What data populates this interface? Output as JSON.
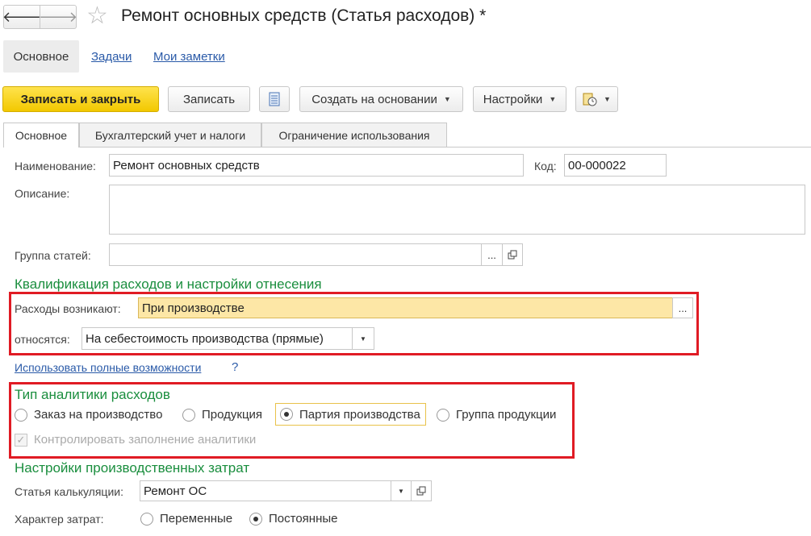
{
  "title": "Ремонт основных средств (Статья расходов) *",
  "nav": {
    "back": "🡐",
    "forward": "🡒",
    "star": "☆"
  },
  "views": {
    "main": "Основное",
    "tasks": "Задачи",
    "notes": "Мои заметки"
  },
  "toolbar": {
    "save_close": "Записать и закрыть",
    "save": "Записать",
    "create_based": "Создать на основании",
    "settings": "Настройки"
  },
  "tabs": [
    "Основное",
    "Бухгалтерский учет и налоги",
    "Ограничение использования"
  ],
  "form": {
    "name_label": "Наименование:",
    "name_value": "Ремонт основных средств",
    "code_label": "Код:",
    "code_value": "00-000022",
    "desc_label": "Описание:",
    "group_label": "Группа статей:",
    "group_value": ""
  },
  "qualification": {
    "header": "Квалификация расходов и настройки отнесения",
    "arise_label": "Расходы возникают:",
    "arise_value": "При производстве",
    "relate_label": "относятся:",
    "relate_value": "На себестоимость производства (прямые)",
    "full_link": "Использовать полные возможности",
    "help": "?"
  },
  "analytics": {
    "header": "Тип аналитики расходов",
    "options": [
      "Заказ на производство",
      "Продукция",
      "Партия производства",
      "Группа продукции"
    ],
    "selected": "Партия производства",
    "control_label": "Контролировать заполнение аналитики"
  },
  "production": {
    "header": "Настройки производственных затрат",
    "calc_label": "Статья калькуляции:",
    "calc_value": "Ремонт ОС",
    "nature_label": "Характер затрат:",
    "options": [
      "Переменные",
      "Постоянные"
    ],
    "selected": "Постоянные"
  }
}
